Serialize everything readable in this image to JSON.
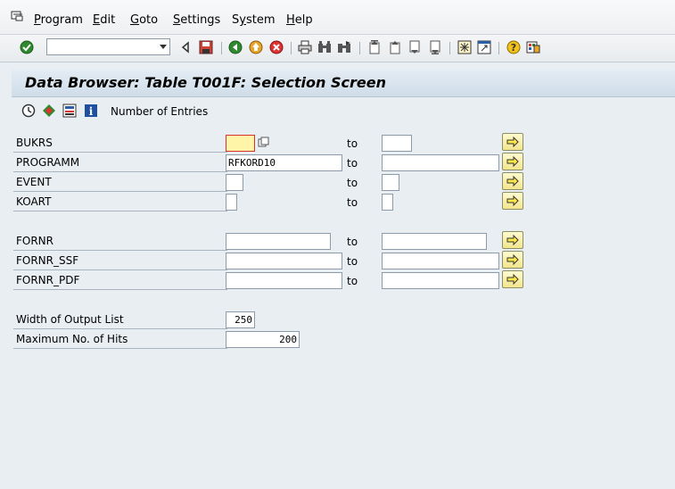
{
  "menu": [
    "Program",
    "Edit",
    "Goto",
    "Settings",
    "System",
    "Help"
  ],
  "menu_underline": [
    "P",
    "E",
    "G",
    "S",
    "y",
    "H"
  ],
  "command_field": {
    "value": ""
  },
  "title": "Data Browser: Table T001F: Selection Screen",
  "app_toolbar": {
    "number_of_entries": "Number of Entries"
  },
  "rows": [
    {
      "label": "BUKRS",
      "low": "",
      "high": "",
      "to": "to"
    },
    {
      "label": "PROGRAMM",
      "low": "RFKORD10",
      "high": "",
      "to": "to"
    },
    {
      "label": "EVENT",
      "low": "",
      "high": "",
      "to": "to"
    },
    {
      "label": "KOART",
      "low": "",
      "high": "",
      "to": "to"
    },
    {
      "label": "FORNR",
      "low": "",
      "high": "",
      "to": "to"
    },
    {
      "label": "FORNR_SSF",
      "low": "",
      "high": "",
      "to": "to"
    },
    {
      "label": "FORNR_PDF",
      "low": "",
      "high": "",
      "to": "to"
    }
  ],
  "settings": {
    "width_label": "Width of Output List",
    "width_value": "250",
    "max_hits_label": "Maximum No. of Hits",
    "max_hits_value": "200"
  },
  "colors": {
    "background": "#e9eef2",
    "multi_button": "#f2e58c",
    "focus_field": "#fff5a8",
    "focus_border": "#d9312b"
  }
}
